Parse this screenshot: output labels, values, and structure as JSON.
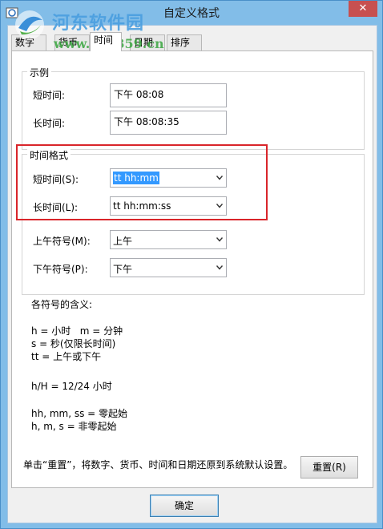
{
  "window": {
    "title": "自定义格式",
    "close_label": "✕"
  },
  "watermark": {
    "name": "河东软件园",
    "url": "www.pc0359.cn"
  },
  "tabs": [
    {
      "label": "数字"
    },
    {
      "label": "货币"
    },
    {
      "label": "时间"
    },
    {
      "label": "日期"
    },
    {
      "label": "排序"
    }
  ],
  "example": {
    "legend": "示例",
    "short_label": "短时间:",
    "short_value": "下午 08:08",
    "long_label": "长时间:",
    "long_value": "下午 08:08:35"
  },
  "formats": {
    "legend": "时间格式",
    "short_label": "短时间(S):",
    "short_value": "tt hh:mm",
    "long_label": "长时间(L):",
    "long_value": "tt hh:mm:ss",
    "am_label": "上午符号(M):",
    "am_value": "上午",
    "pm_label": "下午符号(P):",
    "pm_value": "下午"
  },
  "meaning": {
    "title": "各符号的含义:",
    "line1": "h = 小时   m = 分钟",
    "line2": "s = 秒(仅限长时间)",
    "line3": "tt = 上午或下午",
    "line4": "h/H = 12/24 小时",
    "line5": "hh, mm, ss = 零起始",
    "line6": "h, m, s = 非零起始"
  },
  "note": "单击“重置”，将数字、货币、时间和日期还原到系统默认设置。",
  "buttons": {
    "reset": "重置(R)",
    "ok": "确定"
  },
  "colors": {
    "highlight": "#d9252a",
    "selection": "#3399ff"
  }
}
